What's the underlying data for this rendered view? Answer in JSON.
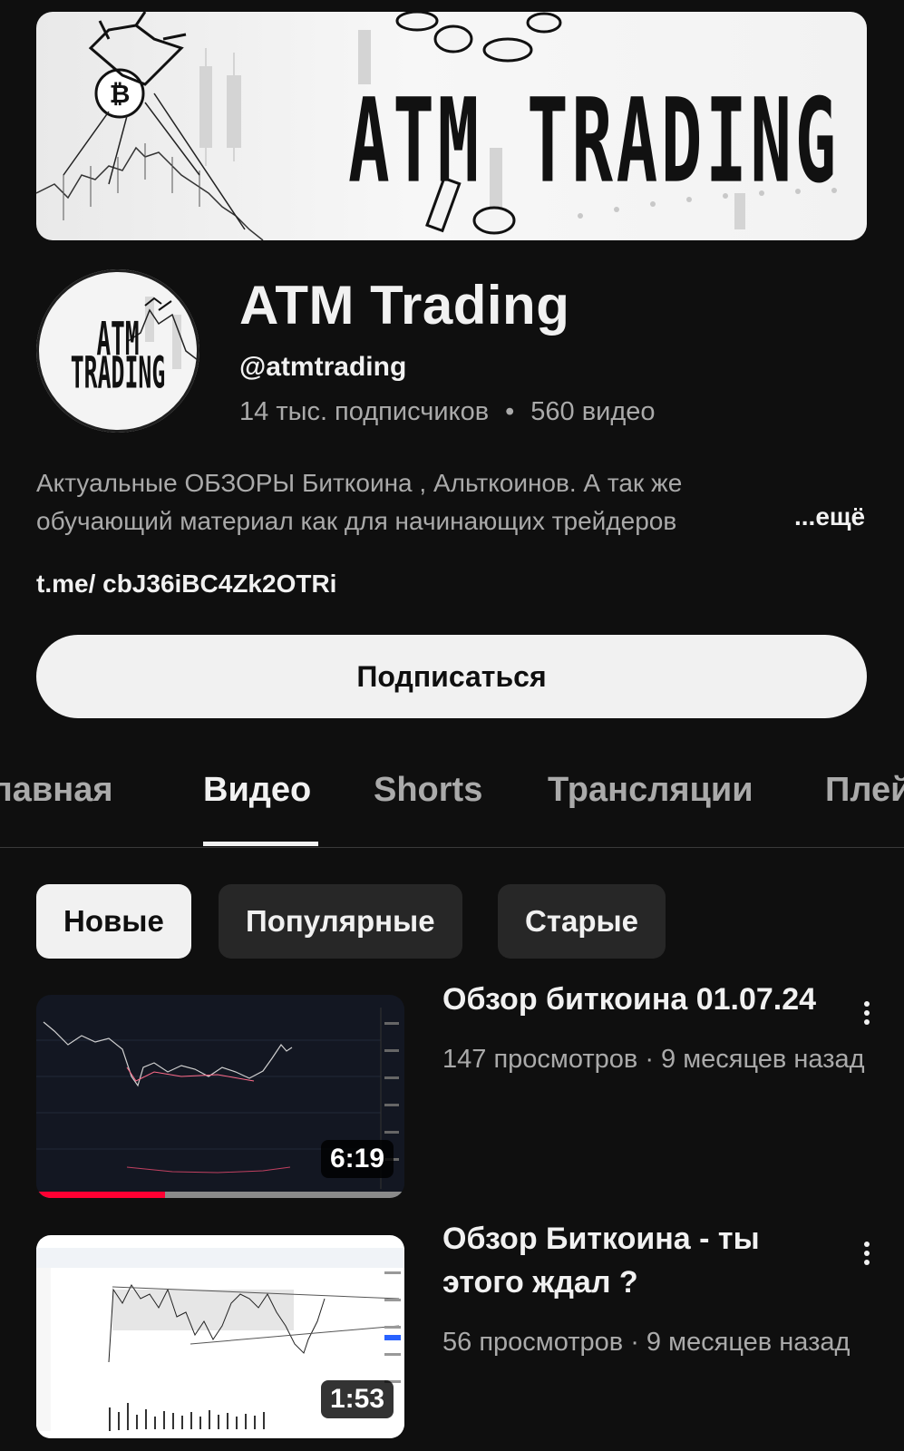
{
  "banner": {
    "title": "ATM  TRADING"
  },
  "avatar": {
    "line1": "ATM",
    "line2": "TRADING"
  },
  "channel": {
    "name": "ATM Trading",
    "handle": "@atmtrading",
    "subscribers": "14 тыс. подписчиков",
    "separator": "•",
    "videos": "560 видео",
    "description_line1": "Актуальные ОБЗОРЫ Биткоина , Альткоинов. А так же",
    "description_line2": "обучающий материал как для начинающих трейдеров",
    "more_label": "...ещё",
    "link": "t.me/ cbJ36iBC4Zk2OTRi"
  },
  "subscribe_label": "Подписаться",
  "tabs": [
    {
      "label": "Главная"
    },
    {
      "label": "Видео"
    },
    {
      "label": "Shorts"
    },
    {
      "label": "Трансляции"
    },
    {
      "label": "Плейлисты"
    }
  ],
  "chips": [
    {
      "label": "Новые"
    },
    {
      "label": "Популярные"
    },
    {
      "label": "Старые"
    }
  ],
  "videos": [
    {
      "title": "Обзор биткоина 01.07.24",
      "meta": "147 просмотров · 9 месяцев назад",
      "duration": "6:19",
      "progress": 0.35
    },
    {
      "title": "Обзор Биткоина - ты этого ждал ?",
      "meta": "56 просмотров · 9 месяцев назад",
      "duration": "1:53"
    }
  ]
}
